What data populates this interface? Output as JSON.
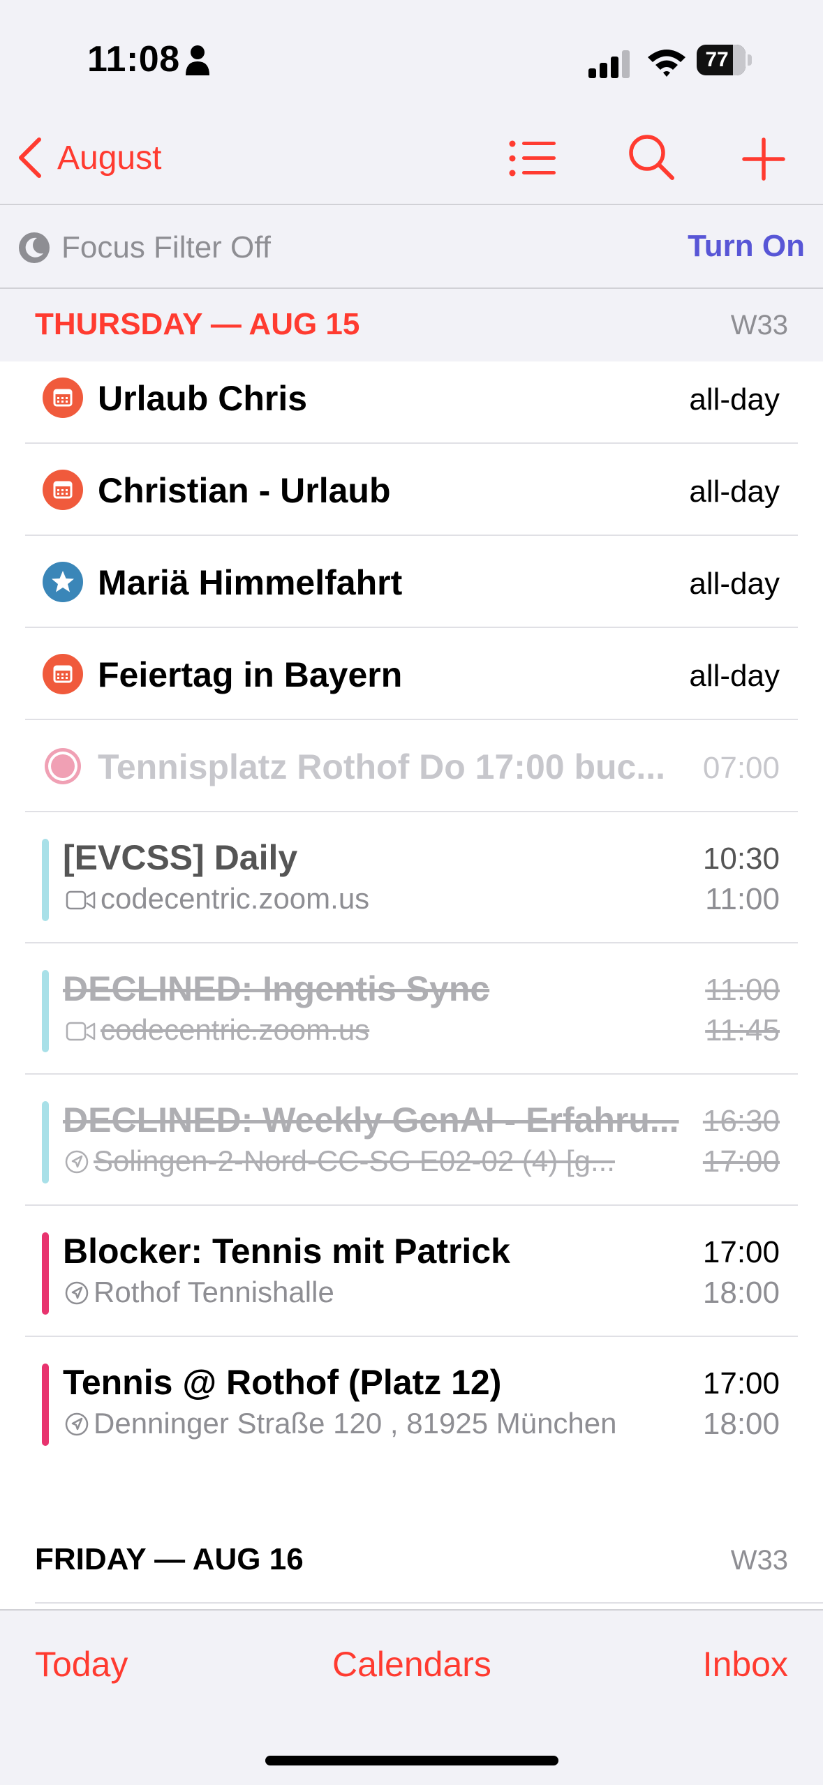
{
  "status": {
    "time": "11:08",
    "battery": "77"
  },
  "nav": {
    "back_label": "August"
  },
  "focus": {
    "label": "Focus Filter Off",
    "action": "Turn On"
  },
  "days": [
    {
      "title": "THURSDAY — AUG 15",
      "week": "W33"
    },
    {
      "title": "FRIDAY — AUG 16",
      "week": "W33"
    }
  ],
  "events": [
    {
      "title": "Urlaub Chris",
      "time": "all-day",
      "icon": "calendar-icon",
      "color": "#f05a3c"
    },
    {
      "title": "Christian - Urlaub",
      "time": "all-day",
      "icon": "calendar-icon",
      "color": "#f05a3c"
    },
    {
      "title": "Mariä Himmelfahrt",
      "time": "all-day",
      "icon": "star-icon",
      "color": "#3a86b8"
    },
    {
      "title": "Feiertag in Bayern",
      "time": "all-day",
      "icon": "calendar-icon",
      "color": "#f05a3c"
    },
    {
      "title": "Tennisplatz Rothof Do 17:00 buc...",
      "time": "07:00",
      "icon": "reminder-circle-icon",
      "color": "#f0a0b4"
    },
    {
      "title": "[EVCSS] Daily",
      "subtitle": "codecentric.zoom.us",
      "start": "10:30",
      "end": "11:00",
      "sub_icon": "video-icon",
      "color": "#a8e0e8"
    },
    {
      "title": "DECLINED: Ingentis Sync",
      "subtitle": "codecentric.zoom.us",
      "start": "11:00",
      "end": "11:45",
      "sub_icon": "video-icon",
      "color": "#a8e0e8"
    },
    {
      "title": "DECLINED: Weekly GenAI - Erfahru...",
      "subtitle": "Solingen-2-Nord-CC-SG E02-02 (4) [g...",
      "start": "16:30",
      "end": "17:00",
      "sub_icon": "location-icon",
      "color": "#a8e0e8"
    },
    {
      "title": "Blocker: Tennis mit Patrick",
      "subtitle": "Rothof Tennishalle",
      "start": "17:00",
      "end": "18:00",
      "sub_icon": "location-icon",
      "color": "#e8336e"
    },
    {
      "title": "Tennis @ Rothof (Platz 12)",
      "subtitle": "Denninger Straße 120 , 81925 München",
      "start": "17:00",
      "end": "18:00",
      "sub_icon": "location-icon",
      "color": "#e8336e"
    }
  ],
  "tabs": {
    "today": "Today",
    "calendars": "Calendars",
    "inbox": "Inbox"
  },
  "colors": {
    "accent": "#ff3b30",
    "focus_action": "#5856d6"
  }
}
